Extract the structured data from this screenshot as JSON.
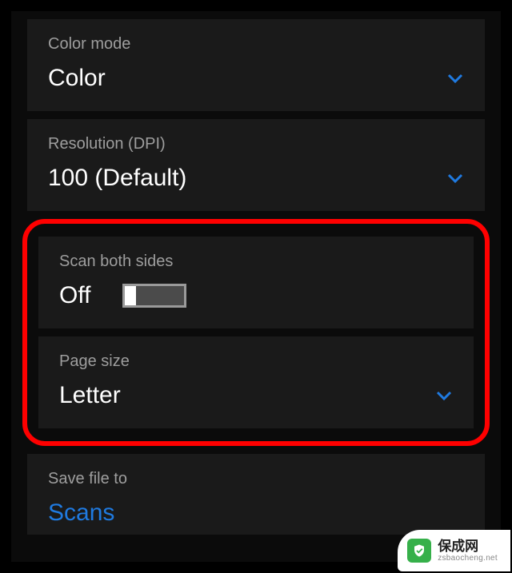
{
  "settings": {
    "color_mode": {
      "label": "Color mode",
      "value": "Color"
    },
    "resolution": {
      "label": "Resolution (DPI)",
      "value": "100 (Default)"
    },
    "scan_both_sides": {
      "label": "Scan both sides",
      "value": "Off"
    },
    "page_size": {
      "label": "Page size",
      "value": "Letter"
    },
    "save_file_to": {
      "label": "Save file to",
      "value": "Scans"
    }
  },
  "watermark": {
    "title": "保成网",
    "subtitle": "zsbaocheng.net"
  }
}
